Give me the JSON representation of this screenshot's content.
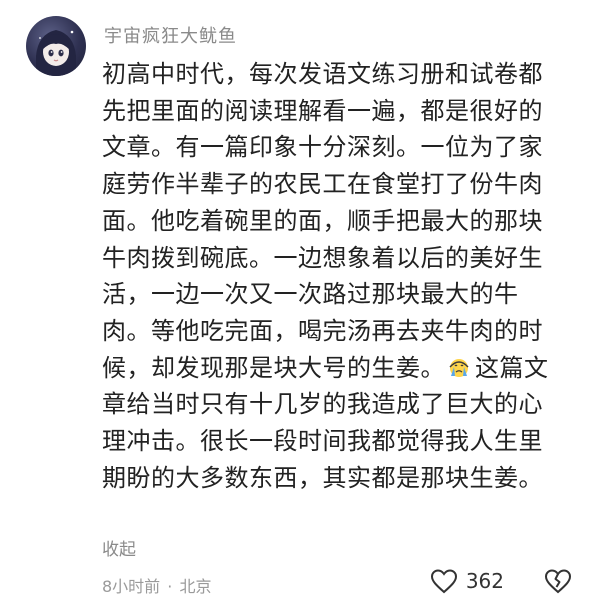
{
  "comment": {
    "username": "宇宙疯狂大鱿鱼",
    "lines": [
      "初高中时代，每次发语文练习册和试卷都",
      "先把里面的阅读理解看一遍，都是很好的",
      "文章。有一篇印象十分深刻。一位为了家",
      "庭劳作半辈子的农民工在食堂打了份牛肉",
      "面。他吃着碗里的面，顺手把最大的那块",
      "牛肉拨到碗底。一边想象着以后的美好生",
      "活，一边一次又一次路过那块最大的牛",
      "肉。等他吃完面，喝完汤再去夹牛肉的时",
      "章给当时只有十几岁的我造成了巨大的心",
      "理冲击。很长一段时间我都觉得我人生里",
      "期盼的大多数东西，其实都是那块生姜。"
    ],
    "emoji_line_before": "候，却发现那是块大号的生姜。",
    "emoji_line_after": "这篇文",
    "emoji_icon": "crying-face-emoji",
    "collapse_label": "收起",
    "time": "8小时前",
    "separator": "·",
    "location": "北京",
    "like_count": "362"
  },
  "icons": {
    "like": "heart-outline-icon",
    "dislike": "broken-heart-icon"
  },
  "colors": {
    "text": "#222222",
    "secondary": "#8a8a8a",
    "avatar_bg": "#2f3152"
  }
}
